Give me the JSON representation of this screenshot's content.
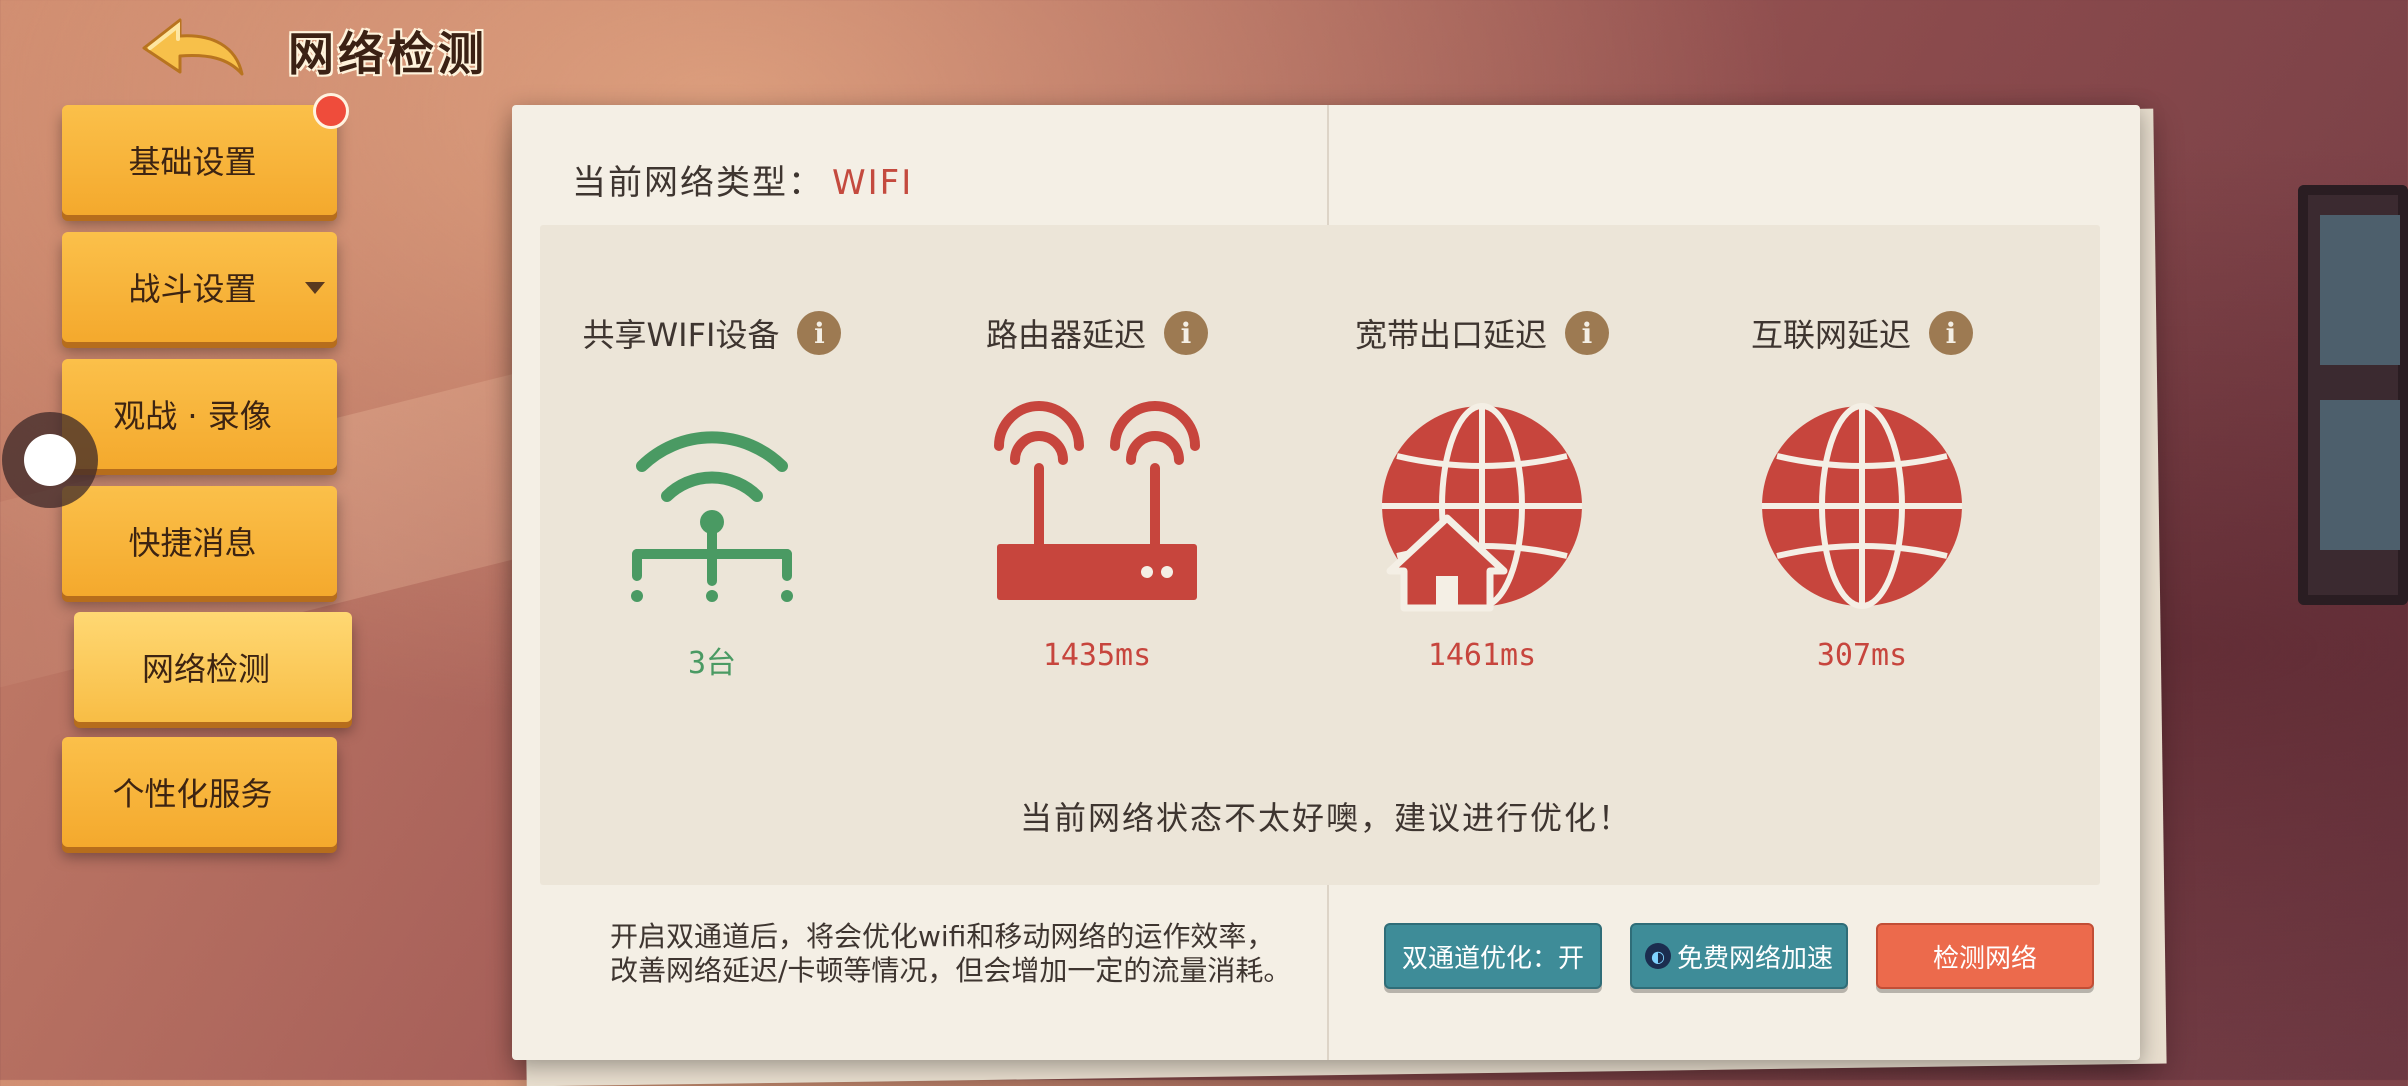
{
  "header": {
    "title": "网络检测",
    "back_icon": "back-arrow-icon"
  },
  "sidebar": {
    "items": [
      {
        "label": "基础设置",
        "badge": true
      },
      {
        "label": "战斗设置",
        "expand_icon": "caret-down-icon"
      },
      {
        "label": "观战 · 录像"
      },
      {
        "label": "快捷消息"
      },
      {
        "label": "网络检测",
        "active": true
      },
      {
        "label": "个性化服务"
      }
    ]
  },
  "network": {
    "type_label": "当前网络类型：",
    "type_value": "WIFI"
  },
  "metrics": [
    {
      "label": "共享WIFI设备",
      "value": "3台",
      "icon": "wifi-devices-icon",
      "color": "#4a9a63"
    },
    {
      "label": "路由器延迟",
      "value": "1435ms",
      "icon": "router-icon",
      "color": "#c7453d"
    },
    {
      "label": "宽带出口延迟",
      "value": "1461ms",
      "icon": "globe-home-icon",
      "color": "#c7453d"
    },
    {
      "label": "互联网延迟",
      "value": "307ms",
      "icon": "globe-icon",
      "color": "#c7453d"
    }
  ],
  "status_message": "当前网络状态不太好噢，建议进行优化！",
  "note": {
    "line1": "开启双通道后，将会优化wifi和移动网络的运作效率，",
    "line2": "改善网络延迟/卡顿等情况，但会增加一定的流量消耗。"
  },
  "buttons": {
    "dual_channel": "双通道优化：开",
    "free_boost": "免费网络加速",
    "detect": "检测网络"
  },
  "colors": {
    "good": "#4a9a63",
    "bad": "#c7453d",
    "teal_button": "#3e8c98",
    "orange_button": "#ec6a4c",
    "menu_yellow": "#f4a92d"
  }
}
